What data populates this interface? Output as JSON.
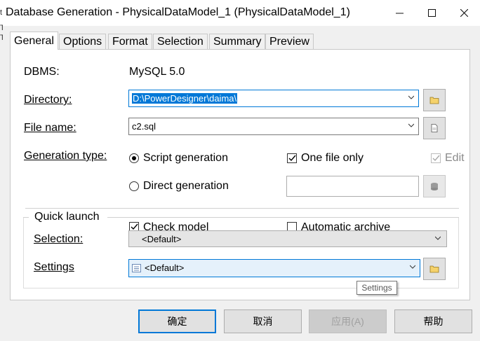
{
  "window": {
    "title": "Database Generation - PhysicalDataModel_1 (PhysicalDataModel_1)",
    "left_sliver_chars": [
      "t",
      "T",
      "T"
    ]
  },
  "tabs": [
    {
      "label": "General",
      "active": true
    },
    {
      "label": "Options",
      "active": false
    },
    {
      "label": "Format",
      "active": false
    },
    {
      "label": "Selection",
      "active": false
    },
    {
      "label": "Summary",
      "active": false
    },
    {
      "label": "Preview",
      "active": false
    }
  ],
  "general": {
    "dbms_label": "DBMS:",
    "dbms_value": "MySQL 5.0",
    "directory_label": "Directory:",
    "directory_value": "D:\\PowerDesigner\\daima\\",
    "filename_label": "File name:",
    "filename_value": "c2.sql",
    "generation_type_label": "Generation type:",
    "script_generation_label": "Script generation",
    "script_generation_selected": true,
    "direct_generation_label": "Direct generation",
    "direct_generation_selected": false,
    "one_file_only_label": "One file only",
    "one_file_only_checked": true,
    "edit_label": "Edit",
    "edit_checked": true,
    "data_source_value": ""
  },
  "quick_launch": {
    "legend": "Quick launch",
    "check_model_label": "Check model",
    "check_model_checked": true,
    "automatic_archive_label": "Automatic archive",
    "automatic_archive_checked": false,
    "selection_label": "Selection:",
    "selection_value": "<Default>",
    "settings_label": "Settings",
    "settings_value": "<Default>"
  },
  "tooltip": "Settings",
  "buttons": {
    "ok": "确定",
    "cancel": "取消",
    "apply": "应用(A)",
    "help": "帮助"
  },
  "colors": {
    "accent": "#0078d7",
    "panel_bg": "#ffffff",
    "dialog_bg": "#f0f0f0"
  }
}
